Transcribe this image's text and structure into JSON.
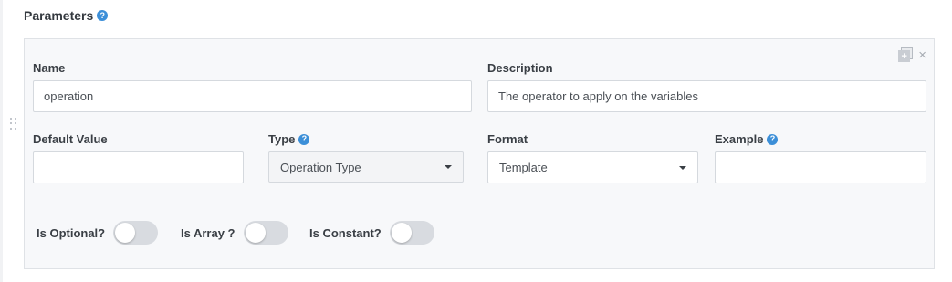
{
  "section": {
    "title": "Parameters",
    "help": "?"
  },
  "card": {
    "close_glyph": "×",
    "copy_glyph": "+",
    "name": {
      "label": "Name",
      "value": "operation"
    },
    "description": {
      "label": "Description",
      "value": "The operator to apply on the variables"
    },
    "default_value": {
      "label": "Default Value",
      "value": ""
    },
    "type": {
      "label": "Type",
      "help": "?",
      "selected": "Operation Type"
    },
    "format": {
      "label": "Format",
      "selected": "Template"
    },
    "example": {
      "label": "Example",
      "help": "?",
      "value": ""
    },
    "toggles": {
      "optional": {
        "label": "Is Optional?",
        "on": false
      },
      "array": {
        "label": "Is Array ?",
        "on": false
      },
      "constant": {
        "label": "Is Constant?",
        "on": false
      }
    }
  },
  "colors": {
    "help_icon": "#3c8fd8",
    "card_bg": "#f7f8fa",
    "toggle_off": "#d8dbe0"
  }
}
